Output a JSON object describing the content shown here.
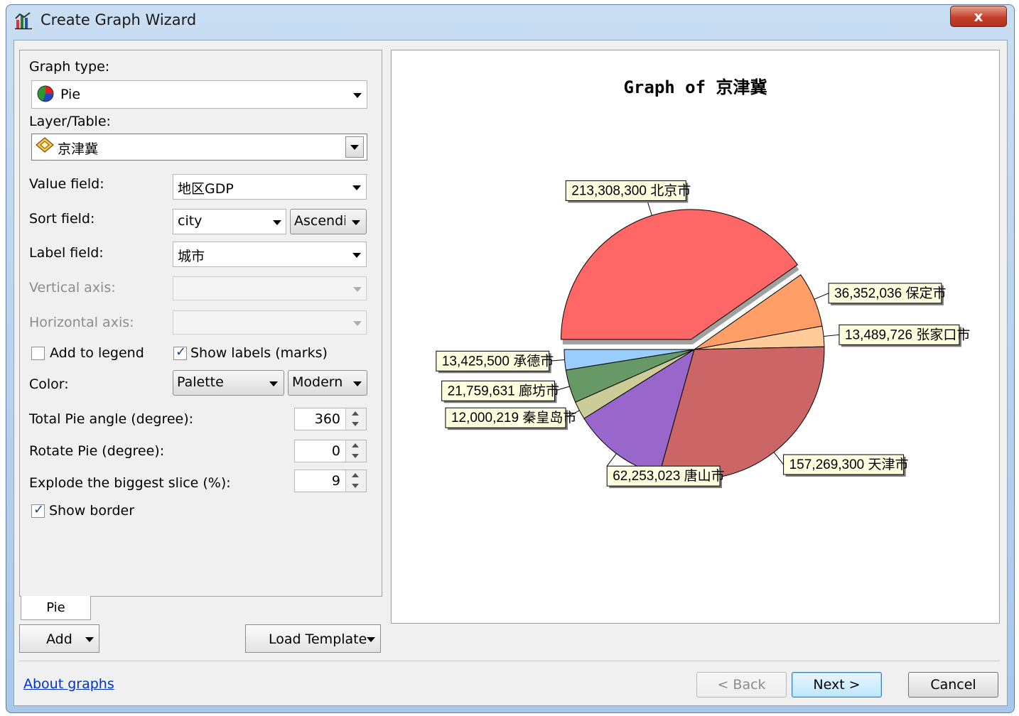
{
  "window": {
    "title": "Create Graph Wizard",
    "close_glyph": "x"
  },
  "form": {
    "graph_type_label": "Graph type:",
    "graph_type_value": "Pie",
    "layer_label": "Layer/Table:",
    "layer_value": "京津冀",
    "value_field_label": "Value field:",
    "value_field_value": "地区GDP",
    "sort_field_label": "Sort field:",
    "sort_field_value": "city",
    "sort_order_value": "Ascendi",
    "label_field_label": "Label field:",
    "label_field_value": "城市",
    "vertical_axis_label": "Vertical axis:",
    "horizontal_axis_label": "Horizontal axis:",
    "add_to_legend_label": "Add to legend",
    "add_to_legend_checked": false,
    "show_labels_label": "Show labels (marks)",
    "show_labels_checked": true,
    "color_label": "Color:",
    "color_mode_value": "Palette",
    "palette_value": "Modern",
    "total_angle_label": "Total Pie angle (degree):",
    "total_angle_value": "360",
    "rotate_label": "Rotate Pie (degree):",
    "rotate_value": "0",
    "explode_label": "Explode the biggest slice (%):",
    "explode_value": "9",
    "show_border_label": "Show border",
    "show_border_checked": true,
    "check_glyph": "✓"
  },
  "tabs": {
    "pie": "Pie"
  },
  "tools": {
    "add_label": "Add",
    "load_template_label": "Load Template"
  },
  "footer": {
    "about_link": "About graphs",
    "back_label": "< Back",
    "next_label": "Next >",
    "cancel_label": "Cancel"
  },
  "chart_data": {
    "type": "pie",
    "title": "Graph of 京津冀",
    "total_angle": 360,
    "rotate": 0,
    "explode_percent": 9,
    "slices": [
      {
        "label": "北京市",
        "value": 213308300,
        "display": "213,308,300 北京市",
        "color": "#ff6666"
      },
      {
        "label": "保定市",
        "value": 36352036,
        "display": "36,352,036 保定市",
        "color": "#ff9e66"
      },
      {
        "label": "张家口市",
        "value": 13489726,
        "display": "13,489,726 张家口市",
        "color": "#ffcc99"
      },
      {
        "label": "天津市",
        "value": 157269300,
        "display": "157,269,300 天津市",
        "color": "#cc6666"
      },
      {
        "label": "唐山市",
        "value": 62253023,
        "display": "62,253,023 唐山市",
        "color": "#9966cc"
      },
      {
        "label": "秦皇岛市",
        "value": 12000219,
        "display": "12,000,219 秦皇岛市",
        "color": "#cccc99"
      },
      {
        "label": "廊坊市",
        "value": 21759631,
        "display": "21,759,631 廊坊市",
        "color": "#669966"
      },
      {
        "label": "承德市",
        "value": 13425500,
        "display": "13,425,500 承德市",
        "color": "#99ccff"
      }
    ]
  }
}
